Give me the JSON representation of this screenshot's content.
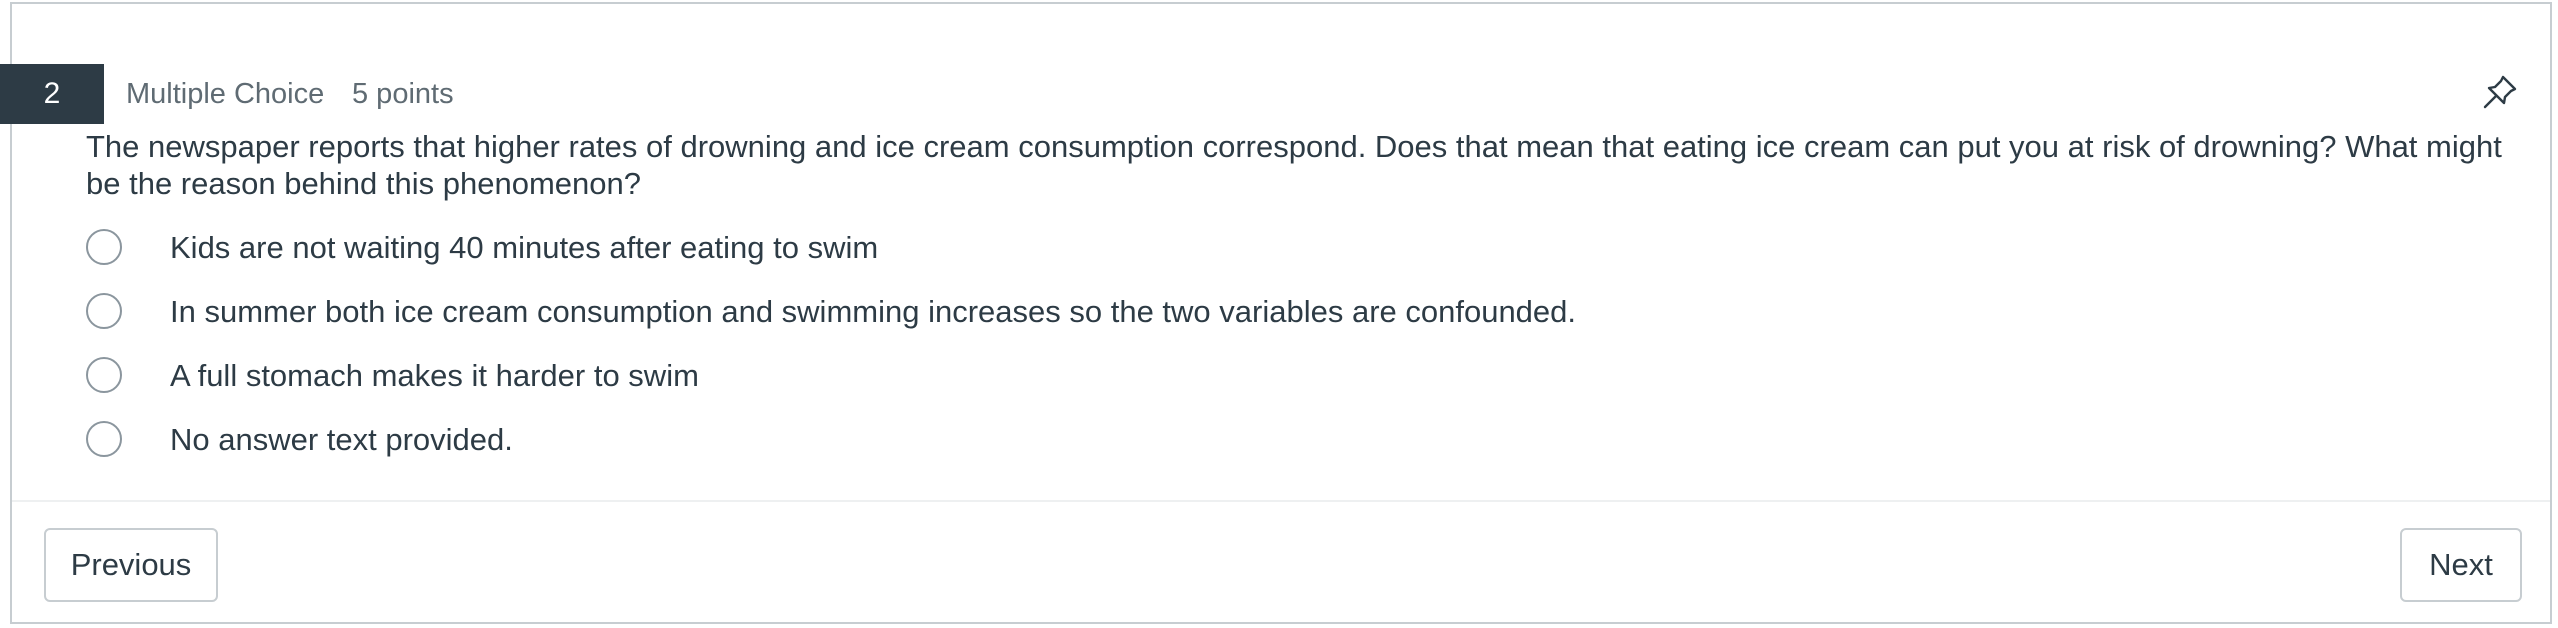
{
  "question": {
    "number": "2",
    "type": "Multiple Choice",
    "points": "5 points",
    "text": "The newspaper reports that higher rates of drowning and ice cream consumption correspond. Does that mean that eating ice cream can put you at risk of drowning? What might be the reason behind this phenomenon?",
    "answers": [
      {
        "label": "Kids are not waiting 40 minutes after eating to swim"
      },
      {
        "label": "In summer both ice cream consumption and swimming increases so the two variables are confounded."
      },
      {
        "label": "A full stomach makes it harder to swim"
      },
      {
        "label": "No answer text provided."
      }
    ],
    "pin_icon": "pin-icon"
  },
  "navigation": {
    "previous_label": "Previous",
    "next_label": "Next"
  },
  "colors": {
    "header_badge": "#2d3b45",
    "text": "#2d3b45",
    "muted_text": "#5f6b73",
    "border": "#c7cdd1"
  }
}
